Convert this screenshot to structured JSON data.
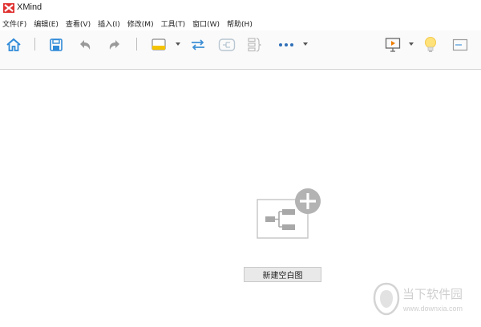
{
  "window": {
    "title": "XMind"
  },
  "menu": [
    "文件(F)",
    "编辑(E)",
    "查看(V)",
    "插入(I)",
    "修改(M)",
    "工具(T)",
    "窗口(W)",
    "帮助(H)"
  ],
  "toolbar": {
    "icons": [
      "home-icon",
      "save-icon",
      "undo-icon",
      "redo-icon",
      "topic-style-icon",
      "relationship-icon",
      "boundary-icon",
      "summary-icon",
      "more-icon",
      "presentation-icon",
      "idea-icon",
      "panel-icon"
    ],
    "accent": "#2f8ad8",
    "highlight": "#f5c400"
  },
  "canvas": {
    "new_blank_label": "新建空白图"
  },
  "watermark": {
    "text": "当下软件园",
    "url": "www.downxia.com"
  }
}
